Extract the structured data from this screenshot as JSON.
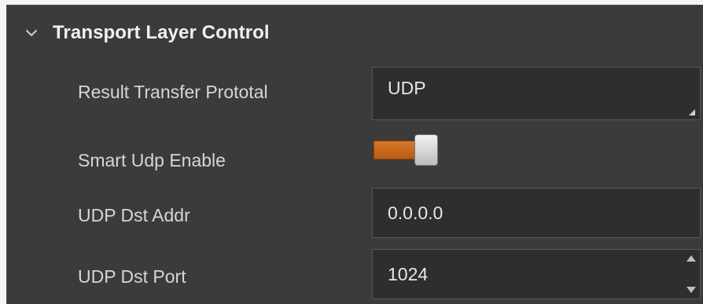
{
  "section": {
    "title": "Transport Layer Control",
    "expanded": true
  },
  "rows": {
    "result_transfer_protocol": {
      "label": "Result Transfer Prototal",
      "value": "UDP"
    },
    "smart_udp_enable": {
      "label": "Smart Udp Enable",
      "enabled": true
    },
    "udp_dst_addr": {
      "label": "UDP Dst Addr",
      "value": "0.0.0.0"
    },
    "udp_dst_port": {
      "label": "UDP Dst Port",
      "value": "1024"
    }
  },
  "colors": {
    "panel_bg": "#3b3b3b",
    "field_bg": "#2e2e2e",
    "toggle_on": "#c8661c"
  },
  "icons": {
    "section_chevron": "chevron-down-icon",
    "select_indicator": "dropdown-corner-icon",
    "spin_up": "spin-up-icon",
    "spin_down": "spin-down-icon"
  }
}
